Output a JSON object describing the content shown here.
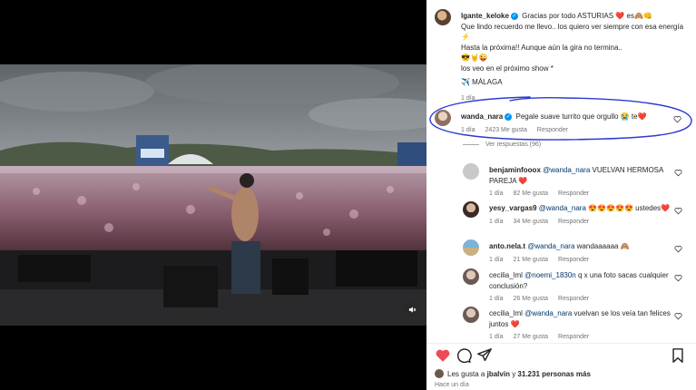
{
  "caption": {
    "username": "lgante_keloke",
    "verified_icon": "verified-badge-icon",
    "line1": "Gracias por todo ASTURIAS",
    "line1_emojis": "❤️ es🙈👊",
    "line2": "Que lindo recuerdo me llevo.. los quiero ver siempre con esa energía ⚡",
    "line3": "Hasta la próxima!! Aunque aún la gira no termina..",
    "line4": "😎🤘😜",
    "line5": "los veo en el próximo show *",
    "line6": "✈️ MÁLAGA",
    "time": "1 día"
  },
  "highlighted_comment": {
    "username": "wanda_nara",
    "text": "Pegale suave turrito que orgullo 😭 te❤️",
    "time": "1 día",
    "likes": "2423 Me gusta",
    "reply": "Responder",
    "highlight_color": "#2b3bd1"
  },
  "view_replies": "Ver respuestas (96)",
  "replies": [
    {
      "username": "benjaminfooox",
      "mention": "@wanda_nara",
      "text": "VUELVAN HERMOSA PAREJA ❤️",
      "time": "1 día",
      "likes": "82 Me gusta",
      "reply": "Responder"
    },
    {
      "username": "yesy_vargas9",
      "mention": "@wanda_nara",
      "text": "😍😍😍😍😍 ustedes❤️",
      "time": "1 día",
      "likes": "34 Me gusta",
      "reply": "Responder"
    },
    {
      "username": "anto.nela.t",
      "mention": "@wanda_nara",
      "text": "wandaaaaaa 🙈",
      "time": "1 día",
      "likes": "21 Me gusta",
      "reply": "Responder"
    },
    {
      "username": "cecilia_lml",
      "mention": "@noemi_1830n",
      "text": "q x una foto sacas cualquier conclusión?",
      "time": "1 día",
      "likes": "26 Me gusta",
      "reply": "Responder"
    },
    {
      "username": "cecilia_lml",
      "mention": "@wanda_nara",
      "text": "vuelvan se los veía tan felices juntos ❤️",
      "time": "1 día",
      "likes": "27 Me gusta",
      "reply": "Responder"
    }
  ],
  "likes_line": {
    "prefix": "Les gusta a",
    "user": "jbalvin",
    "connector": "y",
    "count": "31.231 personas más"
  },
  "posted": "Hace un día",
  "colors": {
    "like_red": "#ed4956",
    "link_blue": "#00376b",
    "verified_blue": "#0095f6"
  }
}
